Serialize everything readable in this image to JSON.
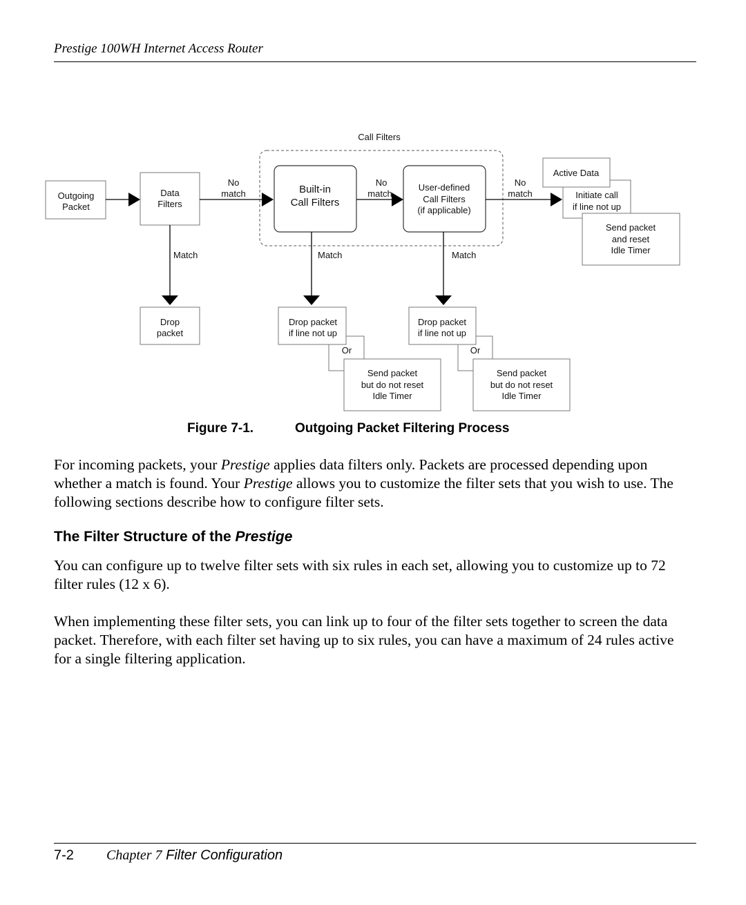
{
  "header": {
    "running_title": "Prestige 100WH Internet Access Router"
  },
  "diagram": {
    "group_label": "Call Filters",
    "nodes": {
      "outgoing_packet": [
        "Outgoing",
        "Packet"
      ],
      "data_filters": [
        "Data",
        "Filters"
      ],
      "builtin_call_filters": [
        "Built-in",
        "Call Filters"
      ],
      "user_defined_call_filters": [
        "User-defined",
        "Call Filters",
        "(if applicable)"
      ],
      "active_data": [
        "Active Data"
      ],
      "initiate_call": [
        "Initiate call",
        "if line not up"
      ],
      "send_reset": [
        "Send packet",
        "and reset",
        "Idle Timer"
      ],
      "drop_packet": [
        "Drop",
        "packet"
      ],
      "drop_if_line_down_1": [
        "Drop packet",
        "if line not up"
      ],
      "send_no_reset_1": [
        "Send packet",
        "but do not reset",
        "Idle Timer"
      ],
      "drop_if_line_down_2": [
        "Drop packet",
        "if line not up"
      ],
      "send_no_reset_2": [
        "Send packet",
        "but do not reset",
        "Idle Timer"
      ]
    },
    "edge_labels": {
      "no": "No",
      "match_lc": "match",
      "match": "Match",
      "or": "Or"
    }
  },
  "figure": {
    "number": "Figure 7-1.",
    "title": "Outgoing Packet Filtering Process"
  },
  "paragraphs": {
    "p1": {
      "a": "For incoming packets, your ",
      "b": "Prestige",
      "c": " applies data filters only. Packets are processed depending upon whether a match is found. Your ",
      "d": "Prestige",
      "e": " allows you to customize the filter sets that you wish to use. The following sections describe how to configure filter sets."
    },
    "heading": {
      "plain": "The Filter Structure of the ",
      "italic": "Prestige"
    },
    "p2": "You can configure up to twelve filter sets with six rules in each set, allowing you to customize up to 72 filter rules (12 x 6).",
    "p3": "When implementing these filter sets, you can link up to four of the filter sets together to screen the data packet. Therefore, with each filter set having up to six rules, you can have a maximum of 24 rules active for a single filtering application."
  },
  "footer": {
    "page_number": "7-2",
    "chapter": "Chapter 7",
    "chapter_title": " Filter Configuration"
  }
}
